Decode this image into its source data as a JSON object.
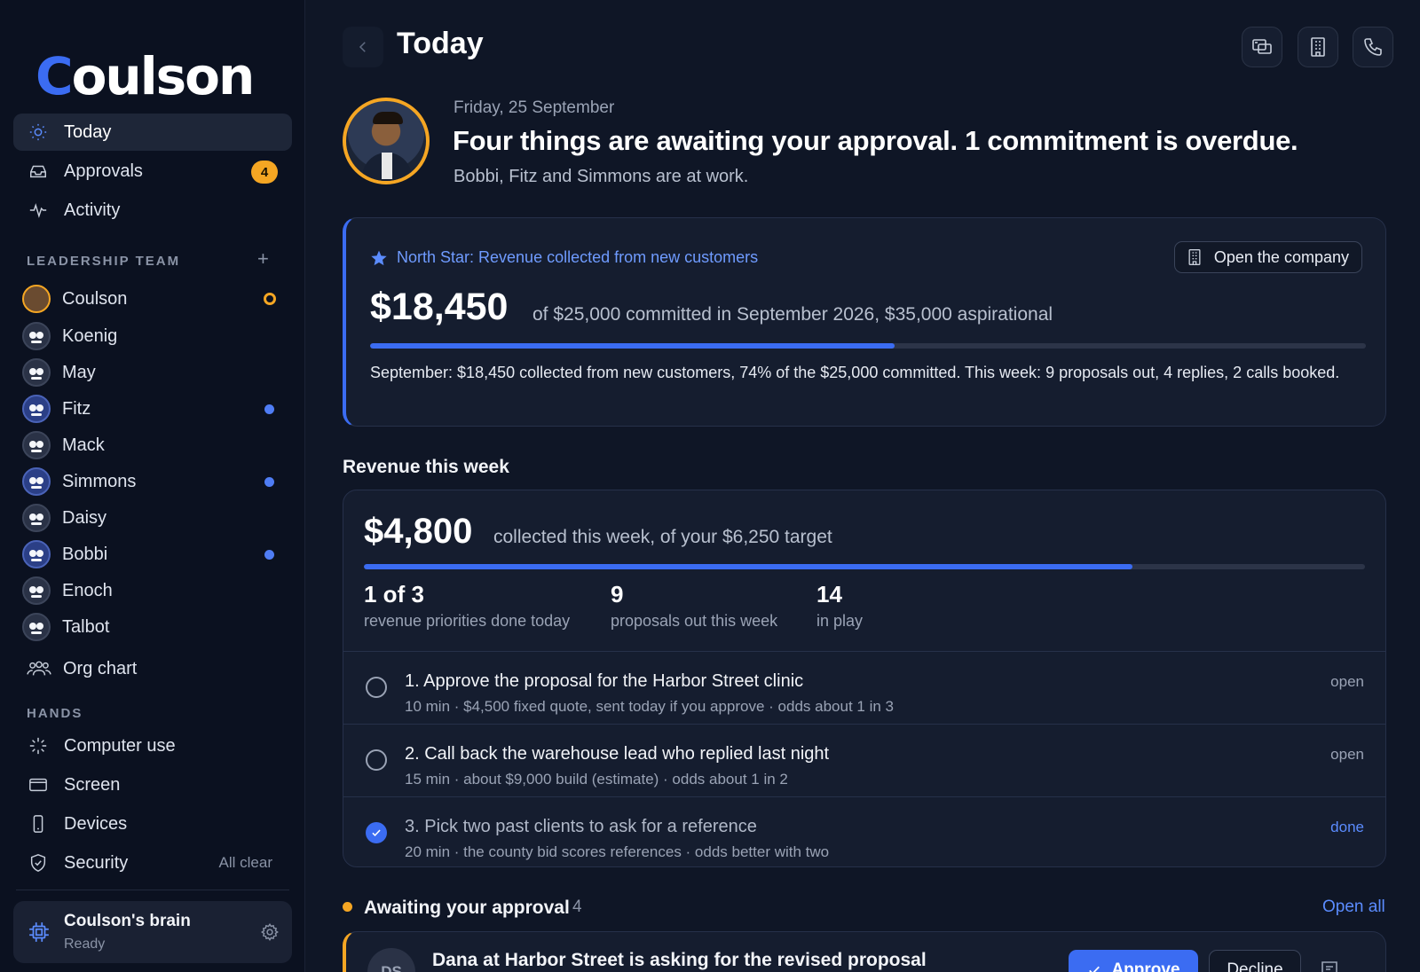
{
  "app": {
    "logo_lead": "C",
    "logo_rest": "oulson"
  },
  "sidebar": {
    "nav": [
      {
        "label": "Today",
        "icon": "sun-icon",
        "active": true
      },
      {
        "label": "Approvals",
        "icon": "inbox-icon",
        "badge": "4"
      },
      {
        "label": "Activity",
        "icon": "activity-icon"
      }
    ],
    "team_label": "LEADERSHIP TEAM",
    "team": [
      {
        "name": "Coulson",
        "status": "ring"
      },
      {
        "name": "Koenig"
      },
      {
        "name": "May"
      },
      {
        "name": "Fitz",
        "status": "dot"
      },
      {
        "name": "Mack"
      },
      {
        "name": "Simmons",
        "status": "dot"
      },
      {
        "name": "Daisy"
      },
      {
        "name": "Bobbi",
        "status": "dot"
      },
      {
        "name": "Enoch"
      },
      {
        "name": "Talbot"
      }
    ],
    "org_chart": "Org chart",
    "hands_label": "HANDS",
    "hands": [
      {
        "label": "Computer use",
        "icon": "sparkle-icon"
      },
      {
        "label": "Screen",
        "icon": "screen-icon"
      },
      {
        "label": "Devices",
        "icon": "phone-device-icon"
      },
      {
        "label": "Security",
        "icon": "shield-icon",
        "note": "All clear"
      }
    ],
    "brain": {
      "title": "Coulson's brain",
      "status": "Ready"
    }
  },
  "header": {
    "title": "Today"
  },
  "hero": {
    "date": "Friday, 25 September",
    "headline": "Four things are awaiting your approval. 1 commitment is overdue.",
    "subline": "Bobbi, Fitz and Simmons are at work."
  },
  "north_star": {
    "title": "North Star: Revenue collected from new customers",
    "open_button": "Open the company",
    "amount": "$18,450",
    "context": "of $25,000 committed in September 2026, $35,000 aspirational",
    "progress_fraction": 0.527,
    "description": "September: $18,450 collected from new customers, 74% of the $25,000 committed. This week: 9 proposals out, 4 replies, 2 calls booked."
  },
  "revenue": {
    "section_label": "Revenue this week",
    "amount": "$4,800",
    "context": "collected this week, of your $6,250 target",
    "progress_fraction": 0.768,
    "stats": [
      {
        "value": "1 of 3",
        "label": "revenue priorities done today"
      },
      {
        "value": "9",
        "label": "proposals out this week"
      },
      {
        "value": "14",
        "label": "in play"
      }
    ],
    "priorities": [
      {
        "title": "1. Approve the proposal for the Harbor Street clinic",
        "meta": "10 min · $4,500 fixed quote, sent today if you approve · odds about 1 in 3",
        "status": "open",
        "done": false
      },
      {
        "title": "2. Call back the warehouse lead who replied last night",
        "meta": "15 min · about $9,000 build (estimate) · odds about 1 in 2",
        "status": "open",
        "done": false
      },
      {
        "title": "3. Pick two past clients to ask for a reference",
        "meta": "20 min · the county bid scores references · odds better with two",
        "status": "done",
        "done": true
      }
    ]
  },
  "approvals": {
    "label": "Awaiting your approval",
    "count": "4",
    "open_all": "Open all",
    "first": {
      "initials": "DS",
      "title": "Dana at Harbor Street is asking for the revised proposal",
      "approve": "Approve",
      "decline": "Decline"
    }
  },
  "colors": {
    "accent": "#3b6cf2",
    "warning": "#f5a623",
    "background": "#0f1626",
    "sidebar": "#0b1120"
  }
}
